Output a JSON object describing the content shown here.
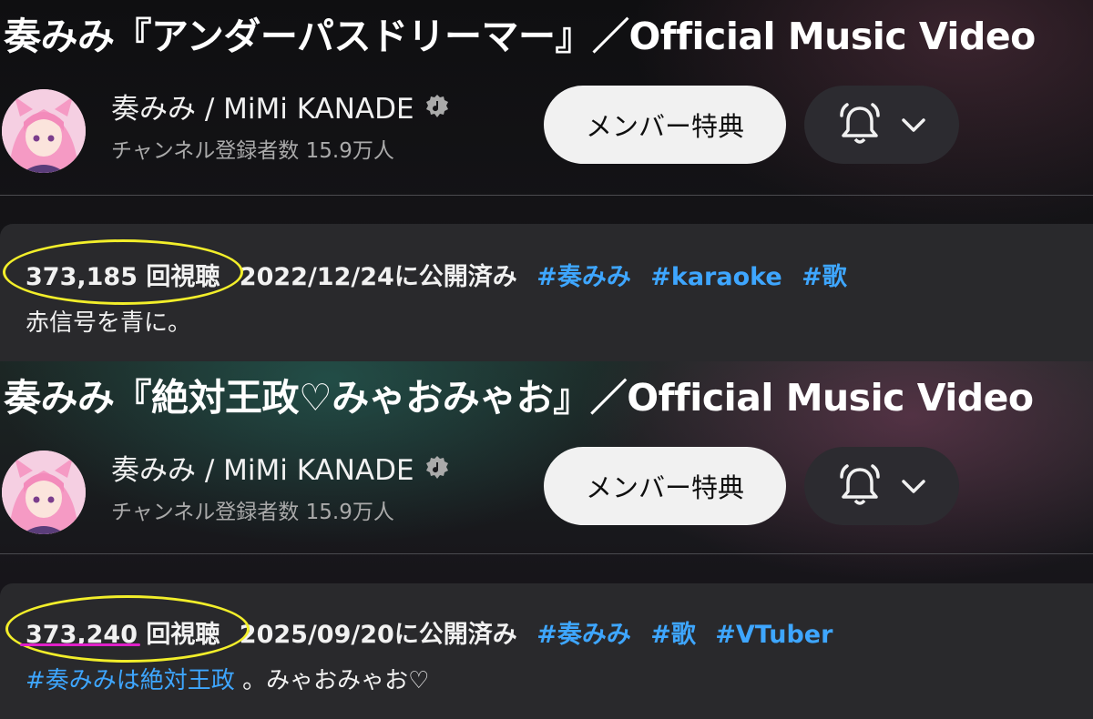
{
  "videos": [
    {
      "title": "奏みみ『アンダーパスドリーマー』／Official Music Video",
      "channel_name": "奏みみ / MiMi KANADE",
      "subscribers": "チャンネル登録者数 15.9万人",
      "member_button_label": "メンバー特典",
      "views": "373,185 回視聴",
      "published": "2022/12/24に公開済み",
      "hashtags": [
        "#奏みみ",
        "#karaoke",
        "#歌"
      ],
      "description": "赤信号を青に。"
    },
    {
      "title": "奏みみ『絶対王政♡みゃおみゃお』／Official Music Video",
      "channel_name": "奏みみ / MiMi KANADE",
      "subscribers": "チャンネル登録者数 15.9万人",
      "member_button_label": "メンバー特典",
      "views": "373,240 回視聴",
      "published": "2025/09/20に公開済み",
      "hashtags": [
        "#奏みみ",
        "#歌",
        "#VTuber"
      ],
      "description_hashtag": "#奏みみは絶対王政",
      "description": "。みゃおみゃお♡"
    }
  ],
  "icons": {
    "verified": "verified-check-icon",
    "bell": "bell-icon",
    "chevron": "chevron-down-icon",
    "avatar": "channel-avatar"
  },
  "colors": {
    "hashtag": "#3ea6ff",
    "annotation_circle": "#f2ee2a",
    "annotation_underline": "#e020c8",
    "description_box": "#29292c"
  }
}
